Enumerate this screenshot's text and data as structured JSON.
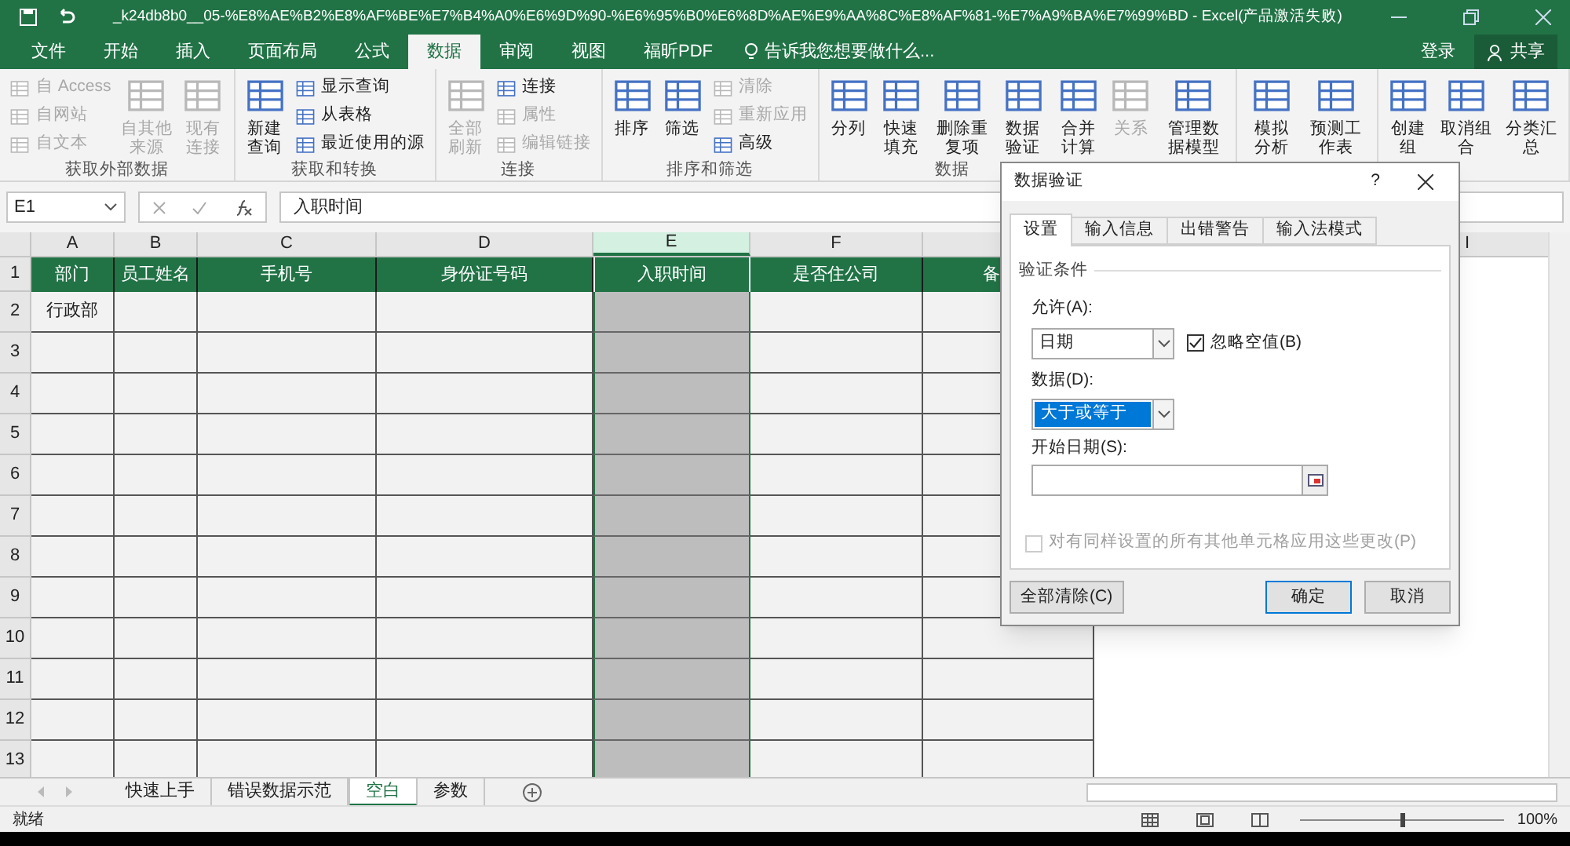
{
  "title_bar": {
    "filename": "_k24db8b0__05-%E8%AE%B2%E8%AF%BE%E7%B4%A0%E6%9D%90-%E6%95%B0%E6%8D%AE%E9%AA%8C%E8%AF%81-%E7%A9%BA%E7%99%BD - Excel(产品激活失败)",
    "sign_in": "登录",
    "share": "共享"
  },
  "menu_tabs": [
    {
      "label": "文件",
      "selected": false
    },
    {
      "label": "开始",
      "selected": false
    },
    {
      "label": "插入",
      "selected": false
    },
    {
      "label": "页面布局",
      "selected": false
    },
    {
      "label": "公式",
      "selected": false
    },
    {
      "label": "数据",
      "selected": true
    },
    {
      "label": "审阅",
      "selected": false
    },
    {
      "label": "视图",
      "selected": false
    },
    {
      "label": "福昕PDF",
      "selected": false
    }
  ],
  "tell_me": "告诉我您想要做什么...",
  "ribbon_groups": [
    {
      "label": "获取外部数据",
      "items": [
        {
          "kind": "small",
          "label": "自 Access",
          "disabled": true
        },
        {
          "kind": "small",
          "label": "自网站",
          "disabled": true
        },
        {
          "kind": "small",
          "label": "自文本",
          "disabled": true
        },
        {
          "kind": "large",
          "label": "自其他来源",
          "disabled": true
        },
        {
          "kind": "large",
          "label": "现有连接",
          "disabled": true
        }
      ]
    },
    {
      "label": "获取和转换",
      "items": [
        {
          "kind": "large",
          "label": "新建查询",
          "disabled": false
        },
        {
          "kind": "small",
          "label": "显示查询",
          "disabled": false
        },
        {
          "kind": "small",
          "label": "从表格",
          "disabled": false
        },
        {
          "kind": "small",
          "label": "最近使用的源",
          "disabled": false
        }
      ]
    },
    {
      "label": "连接",
      "items": [
        {
          "kind": "large",
          "label": "全部刷新",
          "disabled": true
        },
        {
          "kind": "small",
          "label": "连接",
          "disabled": false
        },
        {
          "kind": "small",
          "label": "属性",
          "disabled": true
        },
        {
          "kind": "small",
          "label": "编辑链接",
          "disabled": true
        }
      ]
    },
    {
      "label": "排序和筛选",
      "items": [
        {
          "kind": "large",
          "label": "排序",
          "disabled": false
        },
        {
          "kind": "large",
          "label": "筛选",
          "disabled": false
        },
        {
          "kind": "small",
          "label": "清除",
          "disabled": true
        },
        {
          "kind": "small",
          "label": "重新应用",
          "disabled": true
        },
        {
          "kind": "small",
          "label": "高级",
          "disabled": false
        }
      ]
    },
    {
      "label": "数据",
      "items": [
        {
          "kind": "large",
          "label": "分列",
          "disabled": false
        },
        {
          "kind": "large",
          "label": "快速填充",
          "disabled": false
        },
        {
          "kind": "large",
          "label": "删除重复项",
          "disabled": false
        },
        {
          "kind": "large",
          "label": "数据验证",
          "disabled": false
        },
        {
          "kind": "large",
          "label": "合并计算",
          "disabled": false
        },
        {
          "kind": "large",
          "label": "关系",
          "disabled": true
        },
        {
          "kind": "large",
          "label": "管理数据模型",
          "disabled": false
        }
      ]
    },
    {
      "items": [
        {
          "kind": "large",
          "label": "模拟分析",
          "disabled": false
        },
        {
          "kind": "large",
          "label": "预测工作表",
          "disabled": false
        }
      ]
    },
    {
      "items": [
        {
          "kind": "large",
          "label": "创建组",
          "disabled": false
        },
        {
          "kind": "large",
          "label": "取消组合",
          "disabled": false
        },
        {
          "kind": "large",
          "label": "分类汇总",
          "disabled": false
        }
      ]
    }
  ],
  "name_box": "E1",
  "formula": "入职时间",
  "columns": [
    {
      "label": "A",
      "selected": false
    },
    {
      "label": "B",
      "selected": false
    },
    {
      "label": "C",
      "selected": false
    },
    {
      "label": "D",
      "selected": false
    },
    {
      "label": "E",
      "selected": true
    },
    {
      "label": "F",
      "selected": false
    },
    {
      "selected": false
    }
  ],
  "extra_column": "I",
  "header_row": [
    "部门",
    "员工姓名",
    "手机号",
    "身份证号码",
    "入职时间",
    "是否住公司",
    "备"
  ],
  "rows": [
    {
      "number": "2",
      "cell_a": "行政部"
    },
    {
      "number": "3"
    },
    {
      "number": "4"
    },
    {
      "number": "5"
    },
    {
      "number": "6"
    },
    {
      "number": "7"
    },
    {
      "number": "8"
    },
    {
      "number": "9"
    },
    {
      "number": "10"
    },
    {
      "number": "11"
    },
    {
      "number": "12"
    },
    {
      "number": "13"
    }
  ],
  "sheet_tabs": [
    {
      "label": "快速上手",
      "selected": false
    },
    {
      "label": "错误数据示范",
      "selected": false
    },
    {
      "label": "空白",
      "selected": true
    },
    {
      "label": "参数",
      "selected": false
    }
  ],
  "status": "就绪",
  "zoom": "100%",
  "zoom_slider": {
    "level": 0.5
  },
  "header_row_number": "1",
  "dialog": {
    "title": "数据验证",
    "help": "?",
    "tabs": [
      {
        "label": "设置",
        "selected": true
      },
      {
        "label": "输入信息",
        "selected": false
      },
      {
        "label": "出错警告",
        "selected": false
      },
      {
        "label": "输入法模式",
        "selected": false
      }
    ],
    "section": "验证条件",
    "allow_label": "允许(A):",
    "allow_value": "日期",
    "ignore_blank": {
      "label": "忽略空值(B)",
      "checked": true
    },
    "data_label": "数据(D):",
    "data_value": "大于或等于",
    "start_label": "开始日期(S):",
    "apply_all": {
      "label": "对有同样设置的所有其他单元格应用这些更改(P)",
      "checked": false,
      "disabled": true
    },
    "clear_button": "全部清除(C)",
    "ok_button": "确定",
    "cancel_button": "取消"
  }
}
